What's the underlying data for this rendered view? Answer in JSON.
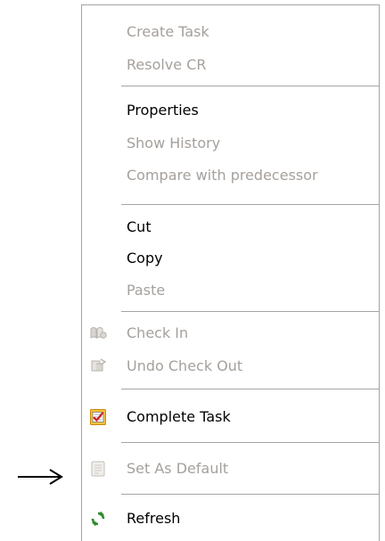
{
  "menu": {
    "groups": [
      {
        "items": [
          {
            "label": "Create Task",
            "enabled": false
          },
          {
            "label": "Resolve CR",
            "enabled": false
          }
        ]
      },
      {
        "items": [
          {
            "label": "Properties",
            "enabled": true
          },
          {
            "label": "Show History",
            "enabled": false
          },
          {
            "label": "Compare with predecessor",
            "enabled": false
          }
        ]
      },
      {
        "items": [
          {
            "label": "Cut",
            "enabled": true
          },
          {
            "label": "Copy",
            "enabled": true
          },
          {
            "label": "Paste",
            "enabled": false
          }
        ]
      },
      {
        "items": [
          {
            "label": "Check In",
            "enabled": false,
            "icon": "check-in-icon"
          },
          {
            "label": "Undo Check Out",
            "enabled": false,
            "icon": "undo-check-out-icon"
          }
        ]
      },
      {
        "items": [
          {
            "label": "Complete Task",
            "enabled": true,
            "icon": "complete-task-icon"
          }
        ]
      },
      {
        "items": [
          {
            "label": "Set As Default",
            "enabled": false,
            "icon": "set-as-default-icon"
          }
        ]
      },
      {
        "items": [
          {
            "label": "Refresh",
            "enabled": true,
            "icon": "refresh-icon"
          }
        ]
      }
    ]
  },
  "annotation": {
    "icon": "right-arrow-icon",
    "points_to": "Set As Default"
  },
  "colors": {
    "text_enabled": "#000000",
    "text_disabled": "#a5a09c",
    "separator": "#a8a4a0",
    "border": "#a3a3a3"
  }
}
